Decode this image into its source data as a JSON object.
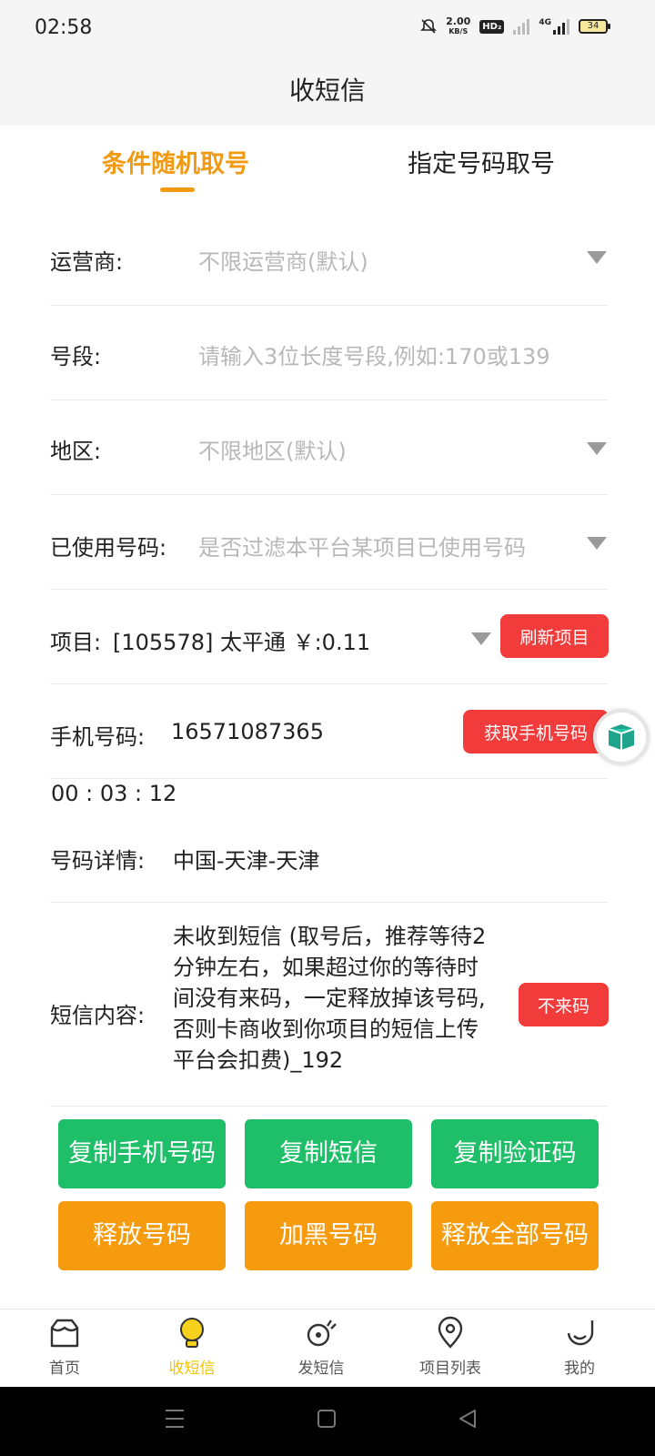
{
  "status_bar": {
    "time": "02:58",
    "speed_value": "2.00",
    "speed_unit": "KB/S",
    "hd_badge": "HD₂",
    "network": "4G",
    "battery": "34"
  },
  "header": {
    "title": "收短信"
  },
  "tabs": [
    {
      "label": "条件随机取号",
      "active": true
    },
    {
      "label": "指定号码取号",
      "active": false
    }
  ],
  "form": {
    "operator": {
      "label": "运营商:",
      "placeholder": "不限运营商(默认)"
    },
    "segment": {
      "label": "号段:",
      "placeholder": "请输入3位长度号段,例如:170或139"
    },
    "region": {
      "label": "地区:",
      "placeholder": "不限地区(默认)"
    },
    "used_numbers": {
      "label": "已使用号码:",
      "placeholder": "是否过滤本平台某项目已使用号码"
    },
    "project": {
      "label": "项目:",
      "value": "[105578] 太平通 ￥:0.11",
      "button": "刷新项目"
    },
    "phone": {
      "label": "手机号码:",
      "value": "16571087365",
      "button": "获取手机号码"
    },
    "timer": "00 : 03 : 12",
    "detail": {
      "label": "号码详情:",
      "value": "中国-天津-天津"
    },
    "sms": {
      "label": "短信内容:",
      "lines": [
        "未收到短信 (取号后，推荐等待2",
        "分钟左右，如果超过你的等待时",
        "间没有来码，一定释放掉该号码,",
        "否则卡商收到你项目的短信上传",
        "平台会扣费)_192"
      ],
      "button": "不来码"
    }
  },
  "actions": {
    "copy_phone": "复制手机号码",
    "copy_sms": "复制短信",
    "copy_code": "复制验证码",
    "release": "释放号码",
    "blacklist": "加黑号码",
    "release_all": "释放全部号码"
  },
  "bottom_nav": [
    {
      "label": "首页",
      "icon": "home-icon"
    },
    {
      "label": "收短信",
      "icon": "bulb-icon",
      "active": true
    },
    {
      "label": "发短信",
      "icon": "send-icon"
    },
    {
      "label": "项目列表",
      "icon": "location-icon"
    },
    {
      "label": "我的",
      "icon": "profile-icon"
    }
  ],
  "colors": {
    "accent": "#f19a12",
    "red": "#f23b3b",
    "green": "#1fbe69",
    "orange": "#f79b0e",
    "active_nav": "#f1c400"
  }
}
